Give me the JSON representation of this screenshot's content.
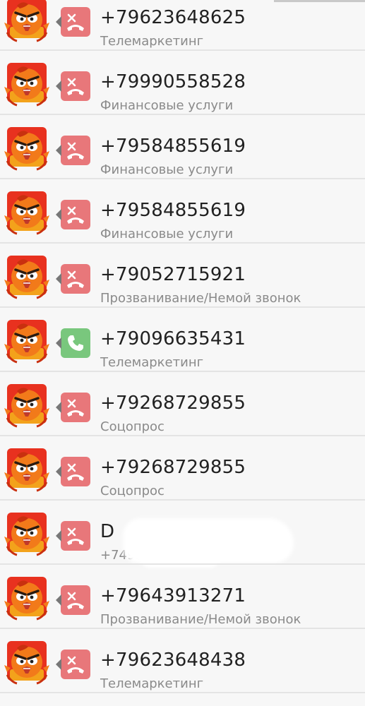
{
  "calls": [
    {
      "number": "+79623648625",
      "label": "Телемаркетинг",
      "type": "missed"
    },
    {
      "number": "+79990558528",
      "label": "Финансовые услуги",
      "type": "missed"
    },
    {
      "number": "+79584855619",
      "label": "Финансовые услуги",
      "type": "missed"
    },
    {
      "number": "+79584855619",
      "label": "Финансовые услуги",
      "type": "missed"
    },
    {
      "number": "+79052715921",
      "label": "Прозванивание/Немой звонок",
      "type": "missed"
    },
    {
      "number": "+79096635431",
      "label": "Телемаркетинг",
      "type": "incoming"
    },
    {
      "number": "+79268729855",
      "label": "Соцопрос",
      "type": "missed"
    },
    {
      "number": "+79268729855",
      "label": "Соцопрос",
      "type": "missed"
    },
    {
      "number": "D",
      "label": "+7499",
      "type": "missed",
      "redacted": true
    },
    {
      "number": "+79643913271",
      "label": "Прозванивание/Немой звонок",
      "type": "missed"
    },
    {
      "number": "+79623648438",
      "label": "Телемаркетинг",
      "type": "missed"
    }
  ],
  "colors": {
    "missed": "#e8777a",
    "incoming": "#79c77d",
    "avatar_bg": "#e8311f",
    "avatar_face": "#f27a1a"
  },
  "icons": {
    "avatar": "angry-bird-avatar-icon",
    "missed": "missed-call-icon",
    "incoming": "incoming-call-icon"
  }
}
